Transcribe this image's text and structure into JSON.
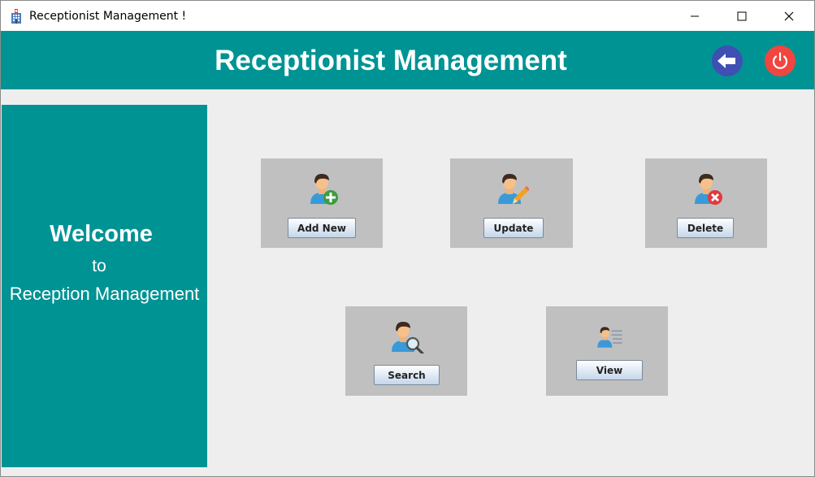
{
  "window": {
    "title": "Receptionist Management !"
  },
  "header": {
    "title": "Receptionist Management",
    "accent_color": "#009394",
    "back_icon": "arrow-left-icon",
    "power_icon": "power-icon"
  },
  "sidebar": {
    "welcome": "Welcome",
    "to": "to",
    "subtitle": "Reception Management"
  },
  "actions": {
    "add": {
      "label": "Add New",
      "icon": "add-user-icon"
    },
    "update": {
      "label": "Update",
      "icon": "edit-user-icon"
    },
    "delete": {
      "label": "Delete",
      "icon": "delete-user-icon"
    },
    "search": {
      "label": "Search",
      "icon": "search-user-icon"
    },
    "view": {
      "label": "View",
      "icon": "view-user-icon"
    }
  }
}
